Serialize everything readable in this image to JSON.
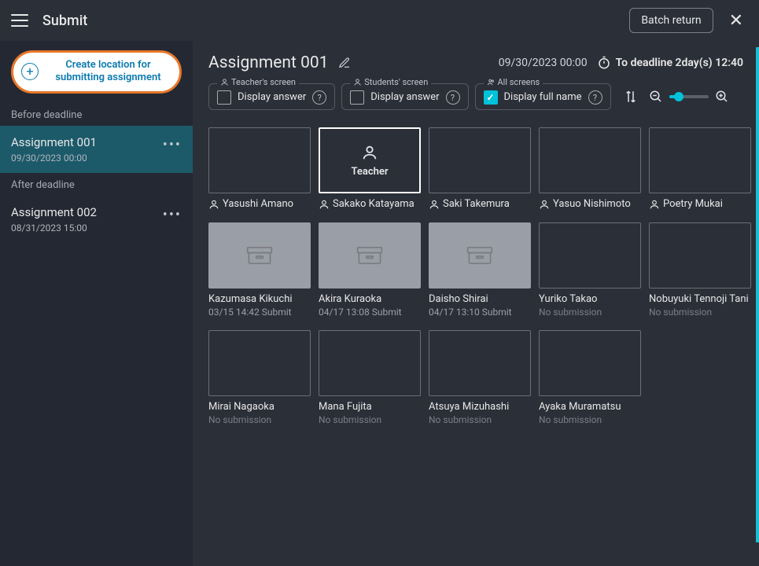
{
  "topbar": {
    "title": "Submit",
    "batch_return": "Batch return"
  },
  "sidebar": {
    "create_label": "Create location for submitting assignment",
    "before_label": "Before deadline",
    "after_label": "After deadline",
    "before": [
      {
        "name": "Assignment 001",
        "date": "09/30/2023 00:00"
      }
    ],
    "after": [
      {
        "name": "Assignment 002",
        "date": "08/31/2023 15:00"
      }
    ]
  },
  "header": {
    "assignment_title": "Assignment 001",
    "due_date": "09/30/2023 00:00",
    "deadline_text": "To deadline 2day(s) 12:40"
  },
  "controls": {
    "teacher_legend": "Teacher's screen",
    "students_legend": "Students' screen",
    "all_legend": "All screens",
    "display_answer": "Display answer",
    "display_full_name": "Display full name"
  },
  "cards": {
    "row1": [
      {
        "name": "Yasushi Amano",
        "type": "person"
      },
      {
        "name": "Sakako Katayama",
        "type": "person",
        "teacher": true,
        "teacher_label": "Teacher"
      },
      {
        "name": "Saki Takemura",
        "type": "person"
      },
      {
        "name": "Yasuo Nishimoto",
        "type": "person"
      },
      {
        "name": "Poetry Mukai",
        "type": "person"
      }
    ],
    "row2": [
      {
        "name": "Kazumasa Kikuchi",
        "sub": "03/15 14:42 Submit",
        "submitted": true
      },
      {
        "name": "Akira Kuraoka",
        "sub": "04/17 13:08 Submit",
        "submitted": true
      },
      {
        "name": "Daisho Shirai",
        "sub": "04/17 13:10 Submit",
        "submitted": true
      },
      {
        "name": "Yuriko Takao",
        "sub": "No submission",
        "nosub": true
      },
      {
        "name": "Nobuyuki Tennoji Tani",
        "sub": "No submission",
        "nosub": true
      }
    ],
    "row3": [
      {
        "name": "Mirai Nagaoka",
        "sub": "No submission",
        "nosub": true
      },
      {
        "name": "Mana Fujita",
        "sub": "No submission",
        "nosub": true
      },
      {
        "name": "Atsuya Mizuhashi",
        "sub": "No submission",
        "nosub": true
      },
      {
        "name": "Ayaka Muramatsu",
        "sub": "No submission",
        "nosub": true
      }
    ]
  }
}
